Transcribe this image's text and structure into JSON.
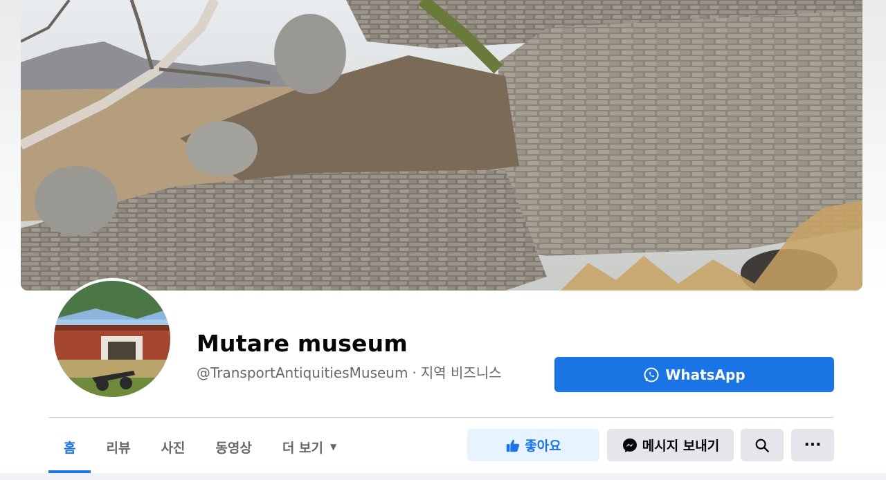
{
  "page": {
    "name": "Mutare museum",
    "handle": "@TransportAntiquitiesMuseum",
    "separator": "·",
    "category": "지역 비즈니스"
  },
  "header": {
    "whatsapp_label": "WhatsApp"
  },
  "tabs": [
    {
      "label": "홈",
      "active": true
    },
    {
      "label": "리뷰",
      "active": false
    },
    {
      "label": "사진",
      "active": false
    },
    {
      "label": "동영상",
      "active": false
    },
    {
      "label": "더 보기",
      "active": false
    }
  ],
  "actions": {
    "like_label": "좋아요",
    "message_label": "메시지 보내기",
    "more_label": "···"
  },
  "icons": {
    "whatsapp": "whatsapp-icon",
    "like": "thumbs-up-icon",
    "messenger": "messenger-icon",
    "search": "search-icon",
    "more": "more-dots-icon",
    "caret": "caret-down-icon"
  },
  "colors": {
    "accent": "#1b74e4",
    "like_bg": "#e7f3ff",
    "secondary_bg": "#e4e6eb",
    "muted_text": "#65676b"
  }
}
